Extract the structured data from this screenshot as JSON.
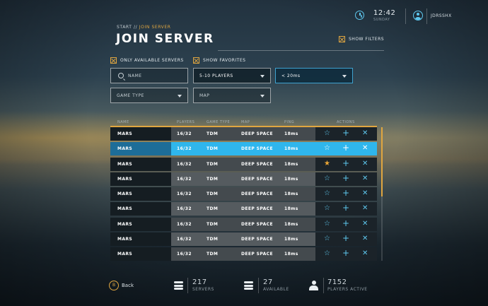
{
  "header": {
    "time": "12:42",
    "day": "SUNDAY",
    "username": "JDRSSHX"
  },
  "breadcrumb": {
    "start": "START //",
    "current": "JOIN SERVER"
  },
  "title": "JOIN SERVER",
  "show_filters_label": "SHOW FILTERS",
  "filters": {
    "only_available": "ONLY AVAILABLE SERVERS",
    "show_favorites": "SHOW FAVORITES",
    "name_placeholder": "NAME",
    "players_value": "5-10 PLAYERS",
    "ping_value": "< 20ms",
    "game_type_value": "GAME TYPE",
    "map_value": "MAP"
  },
  "columns": {
    "name": "NAME",
    "players": "PLAYERS",
    "game_type": "GAME TYPE",
    "map": "MAP",
    "ping": "PING",
    "actions": "ACTIONS"
  },
  "rows": [
    {
      "name": "MARS",
      "players": "16/32",
      "game_type": "TDM",
      "map": "DEEP SPACE",
      "ping": "18ms",
      "favorite": false,
      "selected": false
    },
    {
      "name": "MARS",
      "players": "16/32",
      "game_type": "TDM",
      "map": "DEEP SPACE",
      "ping": "18ms",
      "favorite": false,
      "selected": true
    },
    {
      "name": "MARS",
      "players": "16/32",
      "game_type": "TDM",
      "map": "DEEP SPACE",
      "ping": "18ms",
      "favorite": true,
      "selected": false
    },
    {
      "name": "MARS",
      "players": "16/32",
      "game_type": "TDM",
      "map": "DEEP SPACE",
      "ping": "18ms",
      "favorite": false,
      "selected": false
    },
    {
      "name": "MARS",
      "players": "16/32",
      "game_type": "TDM",
      "map": "DEEP SPACE",
      "ping": "18ms",
      "favorite": false,
      "selected": false
    },
    {
      "name": "MARS",
      "players": "16/32",
      "game_type": "TDM",
      "map": "DEEP SPACE",
      "ping": "18ms",
      "favorite": false,
      "selected": false
    },
    {
      "name": "MARS",
      "players": "16/32",
      "game_type": "TDM",
      "map": "DEEP SPACE",
      "ping": "18ms",
      "favorite": false,
      "selected": false
    },
    {
      "name": "MARS",
      "players": "16/32",
      "game_type": "TDM",
      "map": "DEEP SPACE",
      "ping": "18ms",
      "favorite": false,
      "selected": false
    },
    {
      "name": "MARS",
      "players": "16/32",
      "game_type": "TDM",
      "map": "DEEP SPACE",
      "ping": "18ms",
      "favorite": false,
      "selected": false
    }
  ],
  "footer": {
    "back_key": "B",
    "back_label": "Back",
    "servers_count": "217",
    "servers_label": "SERVERS",
    "available_count": "27",
    "available_label": "AVAILABLE",
    "players_count": "7152",
    "players_label": "PLAYERS ACTIVE"
  },
  "colors": {
    "accent_orange": "#e0a640",
    "accent_blue": "#2fb6ec",
    "icon_blue": "#5ec8ef"
  },
  "icons": {
    "clock": "clock-icon",
    "user": "user-icon",
    "search": "search-icon",
    "star": "star-icon",
    "add": "plus-icon",
    "remove": "close-icon",
    "stack": "stack-icon",
    "person": "person-icon"
  }
}
